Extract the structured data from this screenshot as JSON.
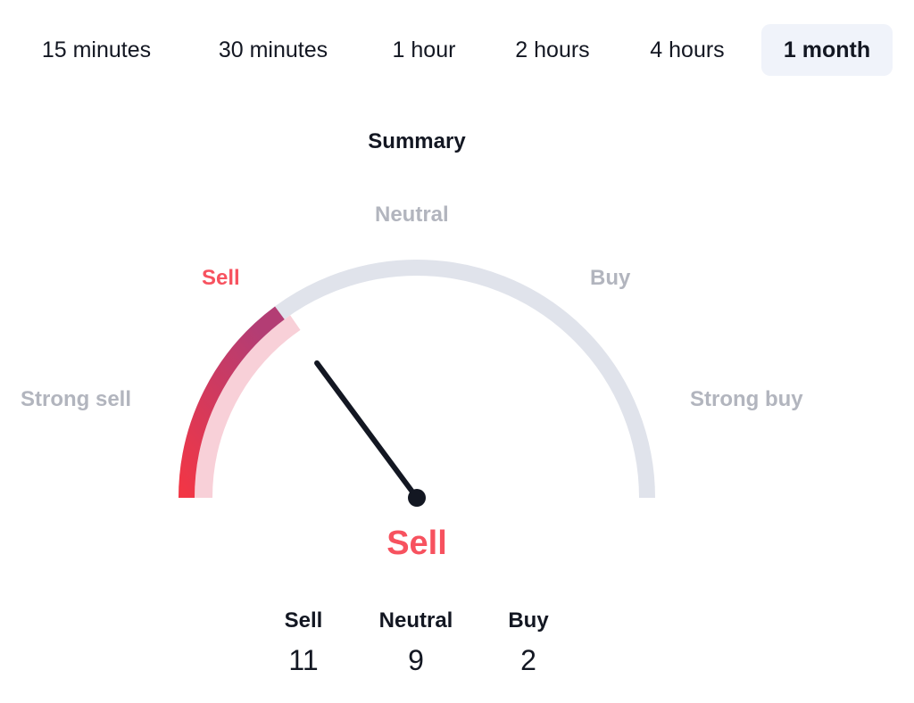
{
  "tabs": [
    {
      "label": "15 minutes",
      "active": false
    },
    {
      "label": "30 minutes",
      "active": false
    },
    {
      "label": "1 hour",
      "active": false
    },
    {
      "label": "2 hours",
      "active": false
    },
    {
      "label": "4 hours",
      "active": false
    },
    {
      "label": "1 month",
      "active": true
    }
  ],
  "gauge": {
    "title": "Summary",
    "labels": {
      "strong_sell": "Strong sell",
      "sell": "Sell",
      "neutral": "Neutral",
      "buy": "Buy",
      "strong_buy": "Strong buy"
    },
    "highlighted": "sell",
    "needle_fraction": 0.297,
    "fill_fraction": 0.297,
    "result": "Sell",
    "colors": {
      "track": "#e0e3eb",
      "fill_start": "#f23645",
      "fill_end": "#b33d74",
      "inner_band": "#f8d0d8",
      "needle": "#131722",
      "sell": "#f7525f",
      "inactive_label": "#b2b5be"
    }
  },
  "counts": [
    {
      "label": "Sell",
      "value": "11"
    },
    {
      "label": "Neutral",
      "value": "9"
    },
    {
      "label": "Buy",
      "value": "2"
    }
  ]
}
